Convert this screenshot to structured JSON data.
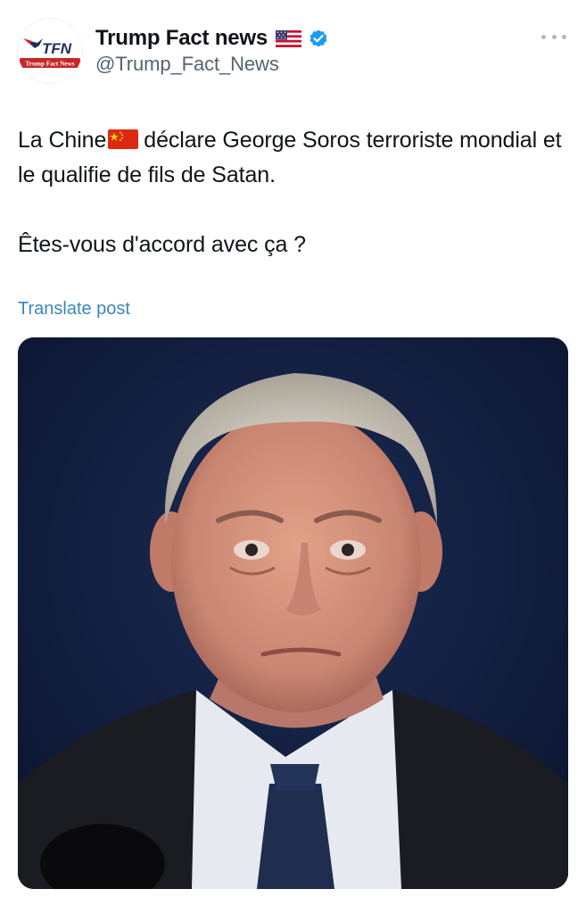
{
  "author": {
    "display_name": "Trump Fact news",
    "handle": "@Trump_Fact_News",
    "avatar_logo_text": "TFN",
    "avatar_logo_subtext": "Trump Fact News",
    "flag_icon": "us-flag-icon",
    "verified_icon": "verified-badge-icon"
  },
  "tweet": {
    "text_line_1_before_flag": "La Chine",
    "text_flag_icon": "china-flag-icon",
    "text_line_1_after_flag": "déclare George Soros terroriste mondial et le qualifie de fils de Satan.",
    "text_line_2": "Êtes-vous d'accord avec ça ?",
    "translate_label": "Translate post"
  },
  "media": {
    "type": "photo",
    "icon": "portrait-photo"
  },
  "colors": {
    "accent_link": "#3a87b8",
    "verified_blue": "#1d9bf0",
    "handle_gray": "#536471",
    "media_background": "#101d3a"
  }
}
